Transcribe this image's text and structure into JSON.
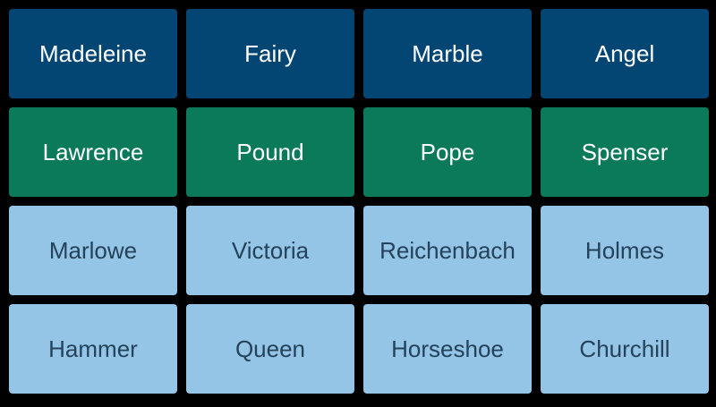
{
  "board": {
    "rows": [
      {
        "status": "solved-a",
        "words": [
          "Madeleine",
          "Fairy",
          "Marble",
          "Angel"
        ]
      },
      {
        "status": "solved-b",
        "words": [
          "Lawrence",
          "Pound",
          "Pope",
          "Spenser"
        ]
      },
      {
        "status": "unsolved",
        "words": [
          "Marlowe",
          "Victoria",
          "Reichenbach",
          "Holmes"
        ]
      },
      {
        "status": "unsolved",
        "words": [
          "Hammer",
          "Queen",
          "Horseshoe",
          "Churchill"
        ]
      }
    ]
  },
  "colors": {
    "background": "#000000",
    "solved_group_1": "#034673",
    "solved_group_2": "#0a7a5a",
    "unsolved_tile": "#94c4e6",
    "solved_text": "#ffffff",
    "unsolved_text": "#24425a"
  }
}
